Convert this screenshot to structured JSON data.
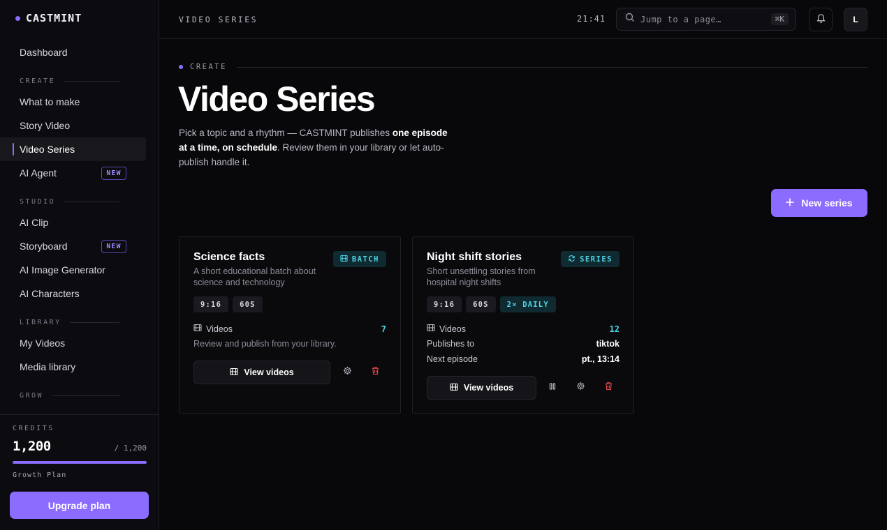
{
  "brand": {
    "name": "CASTMINT"
  },
  "sidebar": {
    "dashboard": "Dashboard",
    "sections": [
      {
        "label": "CREATE",
        "items": [
          {
            "label": "What to make"
          },
          {
            "label": "Story Video"
          },
          {
            "label": "Video Series",
            "active": true
          },
          {
            "label": "AI Agent",
            "badge": "NEW"
          }
        ]
      },
      {
        "label": "STUDIO",
        "items": [
          {
            "label": "AI Clip"
          },
          {
            "label": "Storyboard",
            "badge": "NEW"
          },
          {
            "label": "AI Image Generator"
          },
          {
            "label": "AI Characters"
          }
        ]
      },
      {
        "label": "LIBRARY",
        "items": [
          {
            "label": "My Videos"
          },
          {
            "label": "Media library"
          }
        ]
      },
      {
        "label": "GROW",
        "items": []
      }
    ],
    "credits": {
      "label": "CREDITS",
      "value": "1,200",
      "max": "/ 1,200",
      "fill_fraction": 1.0,
      "plan": "Growth Plan"
    },
    "upgrade_label": "Upgrade plan"
  },
  "topbar": {
    "breadcrumb": "VIDEO SERIES",
    "clock": "21:41",
    "search_placeholder": "Jump to a page…",
    "search_shortcut": "⌘K",
    "avatar_initial": "L"
  },
  "main": {
    "eyebrow": "CREATE",
    "title": "Video Series",
    "desc_part1": "Pick a topic and a rhythm — CASTMINT publishes ",
    "desc_bold": "one episode at a time, on schedule",
    "desc_part2": ". Review them in your library or let auto-publish handle it.",
    "new_series_label": "New series"
  },
  "cards": [
    {
      "title": "Science facts",
      "subtitle": "A short educational batch about science and technology",
      "type": "BATCH",
      "chips": [
        "9:16",
        "60S"
      ],
      "videos_label": "Videos",
      "videos_count": "7",
      "note": "Review and publish from your library.",
      "view_label": "View videos"
    },
    {
      "title": "Night shift stories",
      "subtitle": "Short unsettling stories from hospital night shifts",
      "type": "SERIES",
      "chips": [
        "9:16",
        "60S"
      ],
      "chip_accent": "2× DAILY",
      "videos_label": "Videos",
      "videos_count": "12",
      "publishes_label": "Publishes to",
      "publishes_value": "tiktok",
      "next_label": "Next episode",
      "next_value": "pt., 13:14",
      "view_label": "View videos"
    }
  ],
  "colors": {
    "accent": "#8b6cff",
    "teal": "#4fd3e6",
    "danger": "#e5484d",
    "background": "#08080b"
  }
}
